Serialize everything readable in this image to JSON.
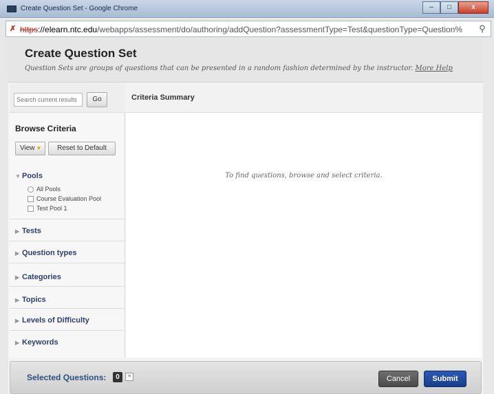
{
  "window": {
    "title": "Create Question Set - Google Chrome",
    "minimize": "–",
    "maximize": "□",
    "close": "x"
  },
  "address": {
    "scheme": "https",
    "host": "://elearn.ntc.edu",
    "path": "/webapps/assessment/do/authoring/addQuestion?assessmentType=Test&questionType=Question%",
    "icons": {
      "security": "x-icon",
      "zoom": "magnifier-icon"
    }
  },
  "header": {
    "title": "Create Question Set",
    "description": "Question Sets are groups of questions that can be presented in a random fashion determined by the instructor.",
    "help_link": "More Help"
  },
  "left": {
    "search_placeholder": "Search current results",
    "go_label": "Go",
    "browse_title": "Browse Criteria",
    "view_label": "View",
    "reset_label": "Reset to Default",
    "sections": {
      "pools": "Pools",
      "tests": "Tests",
      "question_types": "Question types",
      "categories": "Categories",
      "topics": "Topics",
      "levels": "Levels of Difficulty",
      "keywords": "Keywords"
    },
    "pool_options": [
      "All Pools",
      "Course Evaluation Pool",
      "Test Pool 1"
    ]
  },
  "right": {
    "criteria_title": "Criteria Summary",
    "empty_message": "To find questions, browse and select criteria."
  },
  "footer": {
    "selected_label": "Selected Questions:",
    "selected_count": "0",
    "cancel_label": "Cancel",
    "submit_label": "Submit"
  }
}
